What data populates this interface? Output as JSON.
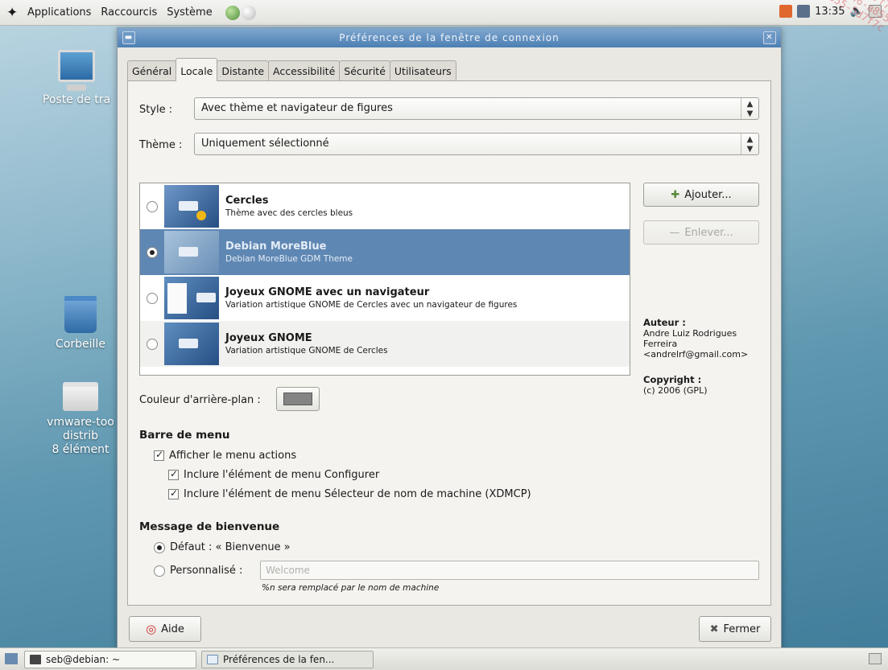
{
  "top_panel": {
    "menus": [
      "Applications",
      "Raccourcis",
      "Système"
    ],
    "time": "13:35"
  },
  "desktop": {
    "icons": [
      {
        "label": "Poste de tra"
      },
      {
        "label": "Corbeille"
      },
      {
        "label": "vmware-too",
        "line2": "distrib",
        "line3": "8 élément"
      }
    ]
  },
  "window": {
    "title": "Préférences de la fenêtre de connexion",
    "tabs": [
      "Général",
      "Locale",
      "Distante",
      "Accessibilité",
      "Sécurité",
      "Utilisateurs"
    ],
    "active_tab": "Locale",
    "style_label": "Style :",
    "style_value": "Avec thème et navigateur de figures",
    "theme_label": "Thème :",
    "theme_value": "Uniquement sélectionné",
    "themes": [
      {
        "name": "Cercles",
        "desc": "Thème avec des cercles bleus",
        "selected": false
      },
      {
        "name": "Debian MoreBlue",
        "desc": "Debian MoreBlue GDM Theme",
        "selected": true
      },
      {
        "name": "Joyeux GNOME avec un navigateur",
        "desc": "Variation artistique GNOME de Cercles avec un navigateur de figures",
        "selected": false
      },
      {
        "name": "Joyeux GNOME",
        "desc": "Variation artistique GNOME de Cercles",
        "selected": false
      }
    ],
    "add_button": "Ajouter...",
    "remove_button": "Enlever...",
    "author_label": "Auteur :",
    "author_line1": "Andre Luiz Rodrigues",
    "author_line2": "Ferreira",
    "author_line3": "<andrelrf@gmail.com>",
    "copyright_label": "Copyright :",
    "copyright_value": "(c) 2006 (GPL)",
    "bg_color_label": "Couleur d'arrière-plan :",
    "bg_color": "#848484",
    "menu_section": "Barre de menu",
    "cb_actions": "Afficher le menu actions",
    "cb_config": "Inclure l'élément de menu Configurer",
    "cb_xdmcp": "Inclure l'élément de menu Sélecteur de nom de machine (XDMCP)",
    "welcome_section": "Message de bienvenue",
    "radio_default": "Défaut : « Bienvenue »",
    "radio_custom": "Personnalisé :",
    "custom_placeholder": "Welcome",
    "hint": "%n sera remplacé par le nom de machine",
    "help_button": "Aide",
    "close_button": "Fermer"
  },
  "bottom_panel": {
    "task1": "seb@debian: ~",
    "task2": "Préférences de la fen..."
  },
  "colors": {
    "selection": "#5f87b3",
    "titlebar": "#4d7fb3"
  }
}
